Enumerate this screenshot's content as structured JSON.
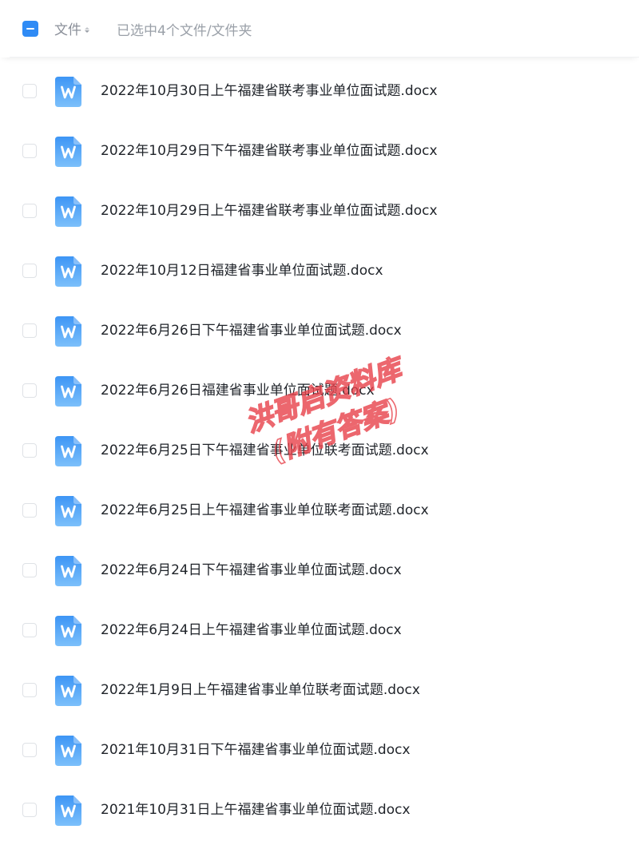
{
  "header": {
    "sort_label": "文件",
    "selection_status": "已选中4个文件/文件夹"
  },
  "files": [
    {
      "name": "2022年10月30日上午福建省联考事业单位面试题.docx",
      "icon": "word-doc-icon"
    },
    {
      "name": "2022年10月29日下午福建省联考事业单位面试题.docx",
      "icon": "word-doc-icon"
    },
    {
      "name": "2022年10月29日上午福建省联考事业单位面试题.docx",
      "icon": "word-doc-icon"
    },
    {
      "name": "2022年10月12日福建省事业单位面试题.docx",
      "icon": "word-doc-icon"
    },
    {
      "name": "2022年6月26日下午福建省事业单位面试题.docx",
      "icon": "word-doc-icon"
    },
    {
      "name": "2022年6月26日福建省事业单位面试题.docx",
      "icon": "word-doc-icon"
    },
    {
      "name": "2022年6月25日下午福建省事业单位联考面试题.docx",
      "icon": "word-doc-icon"
    },
    {
      "name": "2022年6月25日上午福建省事业单位联考面试题.docx",
      "icon": "word-doc-icon"
    },
    {
      "name": "2022年6月24日下午福建省事业单位面试题.docx",
      "icon": "word-doc-icon"
    },
    {
      "name": "2022年6月24日上午福建省事业单位面试题.docx",
      "icon": "word-doc-icon"
    },
    {
      "name": "2022年1月9日上午福建省事业单位联考面试题.docx",
      "icon": "word-doc-icon"
    },
    {
      "name": "2021年10月31日下午福建省事业单位面试题.docx",
      "icon": "word-doc-icon"
    },
    {
      "name": "2021年10月31日上午福建省事业单位面试题.docx",
      "icon": "word-doc-icon"
    }
  ],
  "watermark": {
    "line1": "洪哥启资料库",
    "line2": "(附有答案)",
    "color": "#e8424b"
  },
  "colors": {
    "accent": "#2f8bf5",
    "doc_icon_top": "#3d95f5",
    "doc_icon_bottom": "#7cc0fb"
  }
}
